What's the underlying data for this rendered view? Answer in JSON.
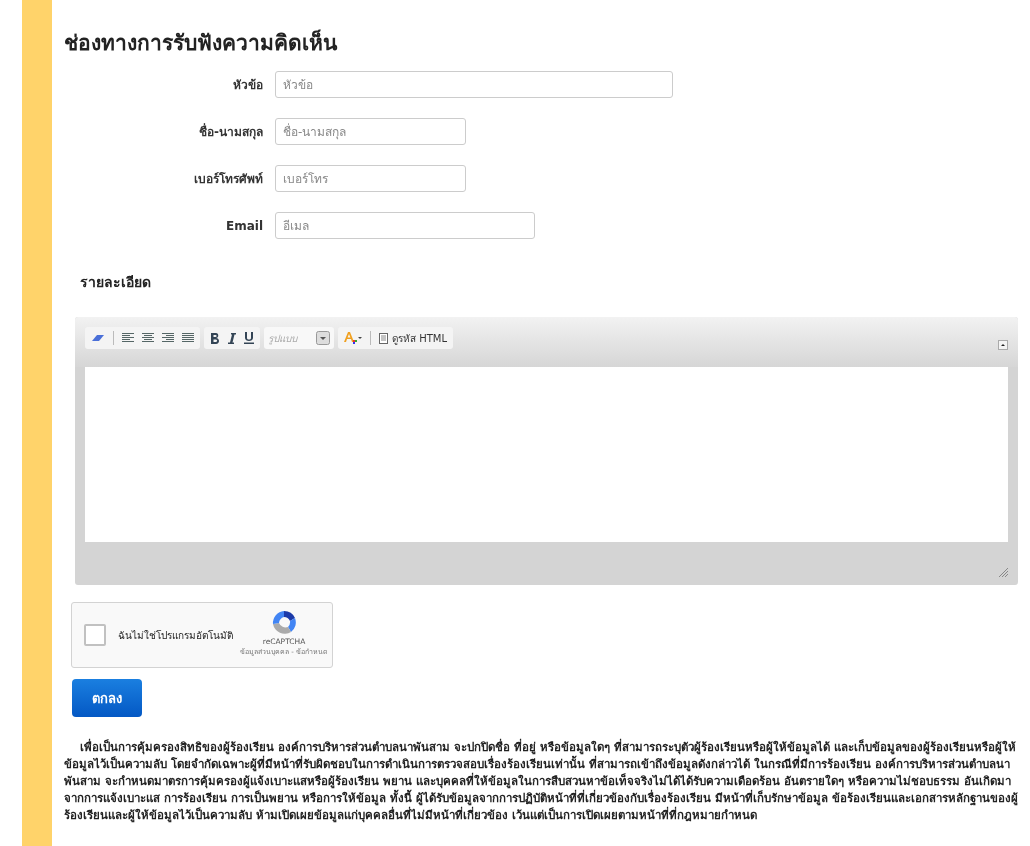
{
  "title": "ช่องทางการรับฟังความคิดเห็น",
  "fields": [
    {
      "label": "หัวข้อ",
      "placeholder": "หัวข้อ"
    },
    {
      "label": "ชื่อ-นามสกุล",
      "placeholder": "ชื่อ-นามสกุล"
    },
    {
      "label": "เบอร์โทรศัพท์",
      "placeholder": "เบอร์โทร"
    },
    {
      "label": "Email",
      "placeholder": "อีเมล"
    }
  ],
  "details_label": "รายละเอียด",
  "editor": {
    "toolbar": [
      {
        "kind": "group",
        "items": [
          {
            "kind": "eraser"
          },
          {
            "kind": "sep"
          },
          {
            "kind": "align-left"
          },
          {
            "kind": "align-center"
          },
          {
            "kind": "align-right"
          },
          {
            "kind": "justify"
          }
        ]
      },
      {
        "kind": "group",
        "items": [
          {
            "kind": "bold"
          },
          {
            "kind": "italic"
          },
          {
            "kind": "underline"
          }
        ]
      },
      {
        "kind": "select",
        "placeholder": "รูปแบบ"
      },
      {
        "kind": "group",
        "items": [
          {
            "kind": "font-color"
          },
          {
            "kind": "sep"
          },
          {
            "kind": "source",
            "label": "ดูรหัส HTML"
          }
        ]
      }
    ]
  },
  "captcha": {
    "label": "ฉันไม่ใช่โปรแกรมอัตโนมัติ",
    "checked": false,
    "brand": "reCAPTCHA",
    "footer": "ข้อมูลส่วนบุคคล - ข้อกำหนด"
  },
  "submit": "ตกลง",
  "notice": "เพื่อเป็นการคุ้มครองสิทธิของผู้ร้องเรียน องค์การบริหารส่วนตำบลนาพันสาม จะปกปิดชื่อ ที่อยู่ หรือข้อมูลใดๆ ที่สามารถระบุตัวผู้ร้องเรียนหรือผู้ให้ข้อมูลได้ และเก็บข้อมูลของผู้ร้องเรียนหรือผู้ให้ข้อมูลไว้เป็นความลับ โดยจำกัดเฉพาะผู้ที่มีหน้าที่รับผิดชอบในการดำเนินการตรวจสอบเรื่องร้องเรียนเท่านั้น ที่สามารถเข้าถึงข้อมูลดังกล่าวได้ ในกรณีที่มีการร้องเรียน องค์การบริหารส่วนตำบลนาพันสาม จะกำหนดมาตรการคุ้มครองผู้แจ้งเบาะแสหรือผู้ร้องเรียน พยาน และบุคคลที่ให้ข้อมูลในการสืบสวนหาข้อเท็จจริงไม่ได้ได้รับความเดือดร้อน อันตรายใดๆ หรือความไม่ชอบธรรม อันเกิดมาจากการแจ้งเบาะแส การร้องเรียน การเป็นพยาน หรือการให้ข้อมูล ทั้งนี้ ผู้ได้รับข้อมูลจากการปฏิบัติหน้าที่ที่เกี่ยวข้องกับเรื่องร้องเรียน มีหน้าที่เก็บรักษาข้อมูล ข้อร้องเรียนและเอกสารหลักฐานของผู้ร้องเรียนและผู้ให้ข้อมูลไว้เป็นความลับ ห้ามเปิดเผยข้อมูลแก่บุคคลอื่นที่ไม่มีหน้าที่เกี่ยวข้อง เว้นแต่เป็นการเปิดเผยตามหน้าที่ที่กฎหมายกำหนด"
}
